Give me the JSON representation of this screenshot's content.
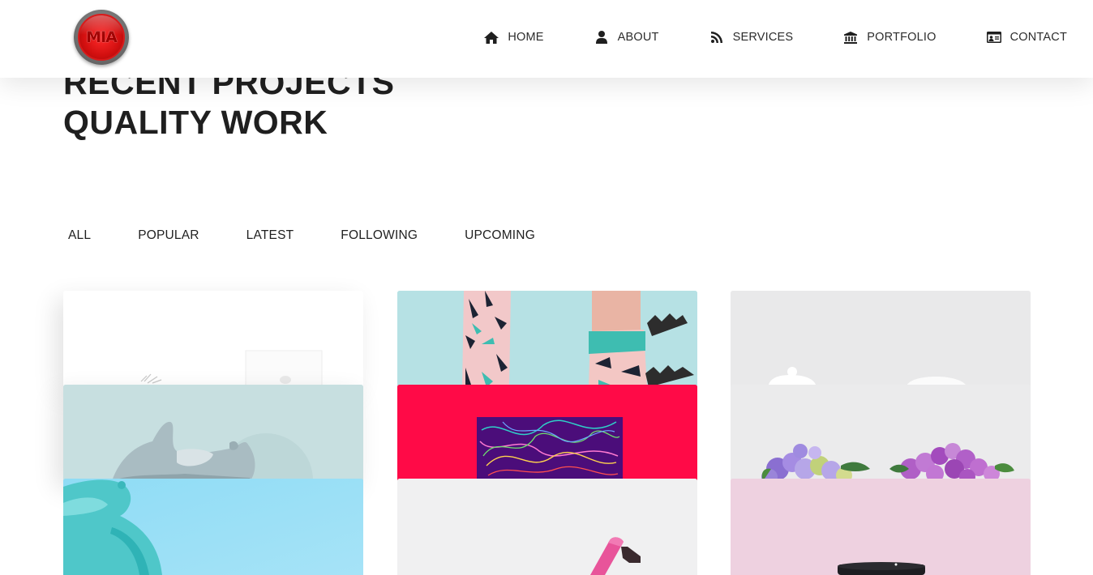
{
  "brand": {
    "logo_text": "MIA"
  },
  "nav": {
    "items": [
      {
        "label": "HOME",
        "icon": "home-icon"
      },
      {
        "label": "ABOUT",
        "icon": "user-icon"
      },
      {
        "label": "SERVICES",
        "icon": "rss-icon"
      },
      {
        "label": "PORTFOLIO",
        "icon": "bank-icon"
      },
      {
        "label": "CONTACT",
        "icon": "id-card-icon"
      }
    ]
  },
  "hero": {
    "line1": "RECENT PROJECTS",
    "line2": "QUALITY WORK"
  },
  "filters": [
    "ALL",
    "POPULAR",
    "LATEST",
    "FOLLOWING",
    "UPCOMING"
  ],
  "colors": {
    "accent_red": "#e3101a",
    "socks_bg": "#b6e1e4",
    "art_bg": "#ff0a47",
    "teapot_bg": "#8fd9f2",
    "pink_bg": "#eed1e0"
  },
  "portfolio": {
    "tiles": [
      {
        "name": "desk-photo"
      },
      {
        "name": "socks-photo"
      },
      {
        "name": "kettle-photo"
      },
      {
        "name": "sneaker-photo"
      },
      {
        "name": "abstract-art-photo"
      },
      {
        "name": "flowers-photo"
      },
      {
        "name": "teapot-photo"
      },
      {
        "name": "marker-photo"
      },
      {
        "name": "mug-photo"
      }
    ]
  }
}
